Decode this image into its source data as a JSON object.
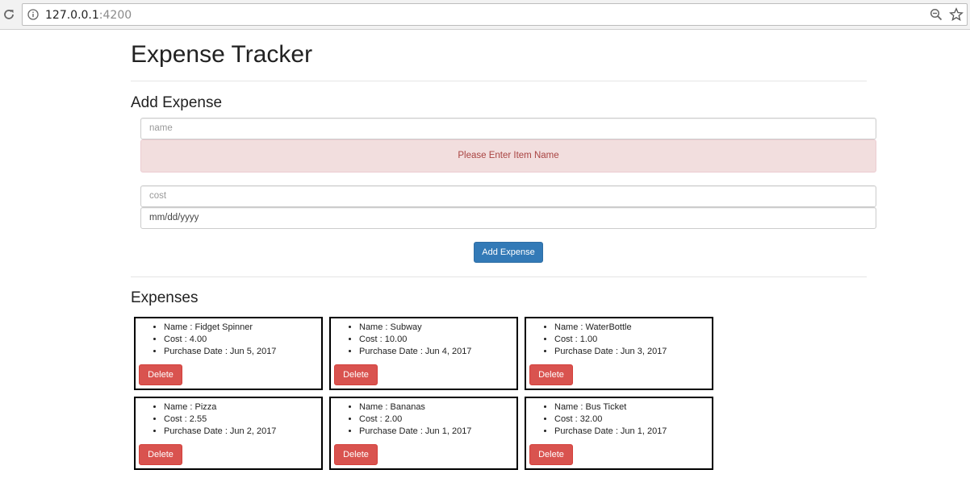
{
  "browser": {
    "url_host": "127.0.0.1",
    "url_port": ":4200"
  },
  "page": {
    "title": "Expense Tracker",
    "add_section_title": "Add Expense",
    "expenses_section_title": "Expenses"
  },
  "form": {
    "name_placeholder": "name",
    "name_error": "Please Enter Item Name",
    "cost_placeholder": "cost",
    "date_value": "mm/dd/yyyy",
    "submit_label": "Add Expense"
  },
  "expenses": [
    {
      "name": "Name : Fidget Spinner",
      "cost": "Cost : 4.00",
      "date": "Purchase Date : Jun 5, 2017",
      "delete_label": "Delete"
    },
    {
      "name": "Name : Subway",
      "cost": "Cost : 10.00",
      "date": "Purchase Date : Jun 4, 2017",
      "delete_label": "Delete"
    },
    {
      "name": "Name : WaterBottle",
      "cost": "Cost : 1.00",
      "date": "Purchase Date : Jun 3, 2017",
      "delete_label": "Delete"
    },
    {
      "name": "Name : Pizza",
      "cost": "Cost : 2.55",
      "date": "Purchase Date : Jun 2, 2017",
      "delete_label": "Delete"
    },
    {
      "name": "Name : Bananas",
      "cost": "Cost : 2.00",
      "date": "Purchase Date : Jun 1, 2017",
      "delete_label": "Delete"
    },
    {
      "name": "Name : Bus Ticket",
      "cost": "Cost : 32.00",
      "date": "Purchase Date : Jun 1, 2017",
      "delete_label": "Delete"
    }
  ],
  "colors": {
    "primary": "#337ab7",
    "danger": "#d9534f",
    "alert_bg": "#f2dede",
    "alert_text": "#a94442"
  }
}
